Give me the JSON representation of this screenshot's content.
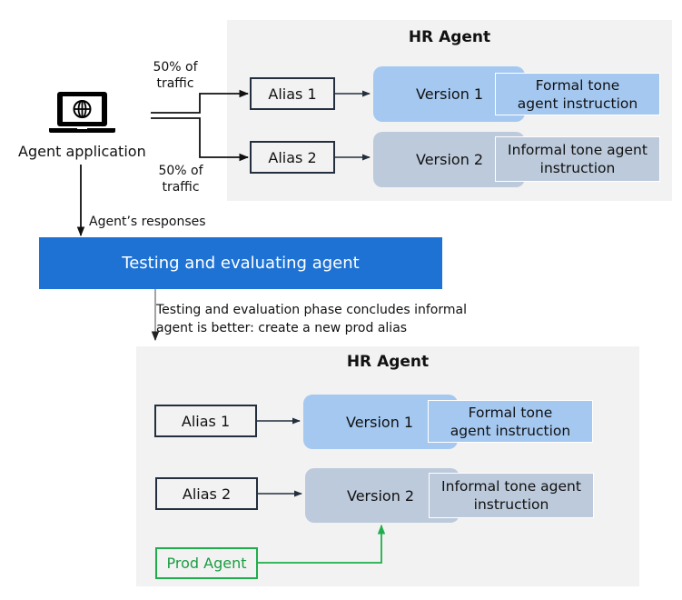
{
  "top_panel": {
    "title": "HR Agent",
    "aliases": [
      {
        "label": "Alias 1"
      },
      {
        "label": "Alias 2"
      }
    ],
    "versions": [
      {
        "label": "Version 1",
        "instruction": "Formal tone agent instruction"
      },
      {
        "label": "Version 2",
        "instruction": "Informal tone agent instruction"
      }
    ]
  },
  "agent_app": {
    "label": "Agent application",
    "icon": "laptop-globe-icon"
  },
  "traffic": {
    "top_label_line1": "50% of",
    "top_label_line2": "traffic",
    "bottom_label_line1": "50% of",
    "bottom_label_line2": "traffic"
  },
  "responses_label": "Agent’s responses",
  "testing_box": {
    "label": "Testing and evaluating agent"
  },
  "conclusion": {
    "line1": "Testing and evaluation phase concludes informal",
    "line2": "agent is better: create a new prod alias"
  },
  "bottom_panel": {
    "title": "HR Agent",
    "aliases": [
      {
        "label": "Alias 1"
      },
      {
        "label": "Alias 2"
      }
    ],
    "versions": [
      {
        "label": "Version 1",
        "instruction": "Formal tone agent instruction"
      },
      {
        "label": "Version 2",
        "instruction": "Informal tone agent instruction"
      }
    ],
    "prod_alias": {
      "label": "Prod Agent"
    }
  },
  "colors": {
    "panel_bg": "#f2f2f2",
    "version1": "#a5c8f1",
    "version2": "#bccadb",
    "testing_bg": "#1e72d4",
    "prod_green": "#1fae4b",
    "alias_border": "#232f3e"
  }
}
